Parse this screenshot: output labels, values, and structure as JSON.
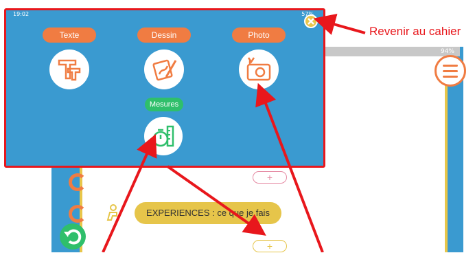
{
  "overlay": {
    "status_time": "19:02",
    "status_right": "57%",
    "tools": [
      {
        "label": "Texte",
        "icon": "text-tool-icon"
      },
      {
        "label": "Dessin",
        "icon": "drawing-tool-icon"
      },
      {
        "label": "Photo",
        "icon": "camera-icon"
      },
      {
        "label": "Mesures",
        "icon": "stopwatch-ruler-icon"
      }
    ],
    "close_icon": "close-icon"
  },
  "background": {
    "status_right": "94%",
    "experiences_label": "EXPERIENCES : ce que je fais",
    "add_label": "+",
    "menu_icon": "hamburger-menu-icon",
    "undo_icon": "undo-icon"
  },
  "annotation": {
    "label": "Revenir au cahier",
    "color": "#e8171c"
  },
  "colors": {
    "panel_blue": "#3a9ad0",
    "orange": "#f07c42",
    "green": "#2fbf6b",
    "yellow": "#e6c54a",
    "red": "#e8171c"
  }
}
